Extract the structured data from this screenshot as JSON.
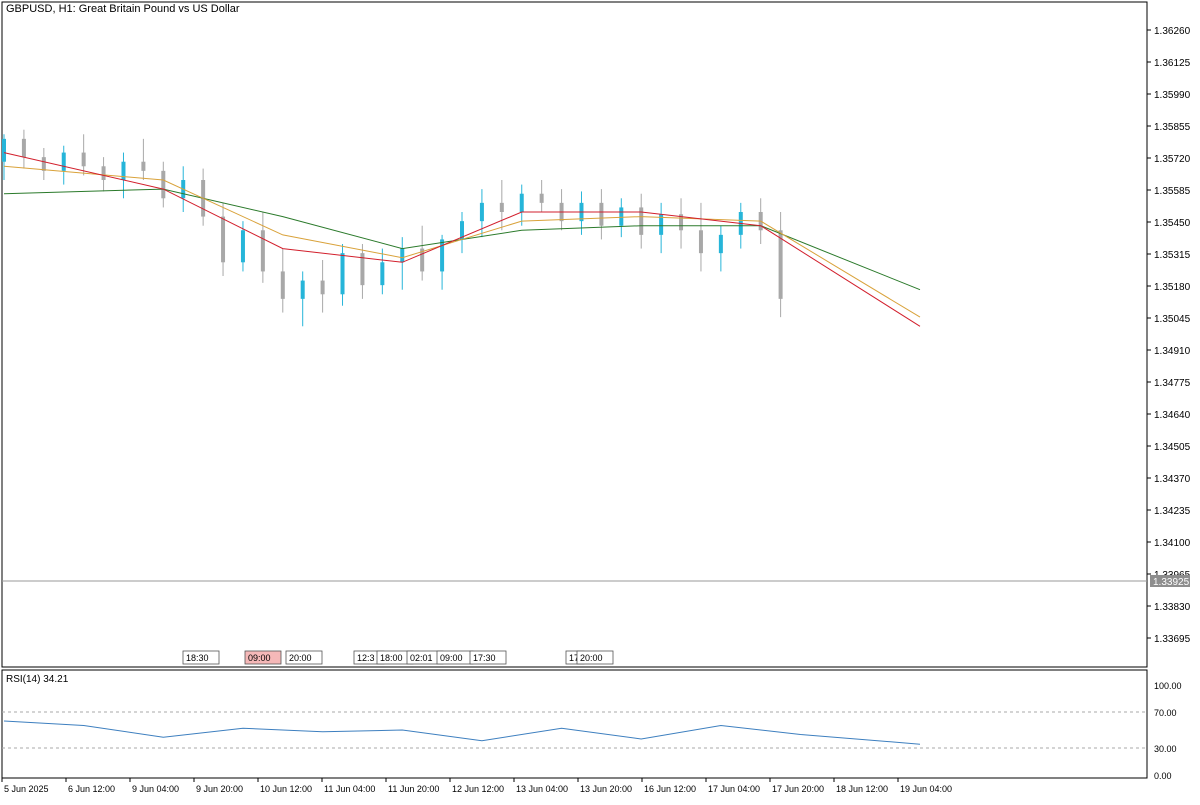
{
  "header": {
    "title": "GBPUSD, H1:  Great Britain Pound vs US Dollar"
  },
  "colors": {
    "bull_candle": "#26b5d9",
    "bear_candle": "#a8a8a8",
    "ma_fast": "#d21f2c",
    "ma_mid": "#d9a23a",
    "ma_slow": "#2b7a2b",
    "rsi_line": "#3d7fbf",
    "grid_frame": "#000000",
    "price_line": "#9a9a9a",
    "event_highlight": "#f5b8b8"
  },
  "price_scale": {
    "labels": [
      "1.36260",
      "1.36125",
      "1.35990",
      "1.35855",
      "1.35720",
      "1.35585",
      "1.35450",
      "1.35315",
      "1.35180",
      "1.35045",
      "1.34910",
      "1.34775",
      "1.34640",
      "1.34505",
      "1.34370",
      "1.34235",
      "1.34100",
      "1.33965",
      "1.33830",
      "1.33695"
    ],
    "current_price": "1.33925"
  },
  "event_markers": [
    {
      "label": "18:30",
      "highlight": false
    },
    {
      "label": "09:00",
      "highlight": true
    },
    {
      "label": "20:00",
      "highlight": false
    },
    {
      "label": "12:3",
      "highlight": false
    },
    {
      "label": "18:00",
      "highlight": false
    },
    {
      "label": "02:01",
      "highlight": false
    },
    {
      "label": "09:00",
      "highlight": false
    },
    {
      "label": "17:30",
      "highlight": false
    },
    {
      "label": "17",
      "highlight": false
    },
    {
      "label": "20:00",
      "highlight": false
    }
  ],
  "rsi_panel": {
    "label": "RSI(14) 34.21",
    "levels": [
      "100.00",
      "70.00",
      "30.00",
      "0.00"
    ]
  },
  "time_axis": {
    "labels": [
      "5 Jun 2025",
      "6 Jun 12:00",
      "9 Jun 04:00",
      "9 Jun 20:00",
      "10 Jun 12:00",
      "11 Jun 04:00",
      "11 Jun 20:00",
      "12 Jun 12:00",
      "13 Jun 04:00",
      "13 Jun 20:00",
      "16 Jun 12:00",
      "17 Jun 04:00",
      "17 Jun 20:00",
      "18 Jun 12:00",
      "19 Jun 04:00"
    ]
  },
  "chart_data": {
    "type": "candlestick",
    "symbol": "GBPUSD",
    "timeframe": "H1",
    "y_range": [
      1.336,
      1.364
    ],
    "grid": false,
    "x_index_range": [
      0,
      230
    ],
    "candles": [
      [
        0,
        1.3578,
        1.359,
        1.357,
        1.3588
      ],
      [
        5,
        1.3588,
        1.3592,
        1.3575,
        1.358
      ],
      [
        10,
        1.358,
        1.3584,
        1.357,
        1.3574
      ],
      [
        15,
        1.3574,
        1.3585,
        1.3568,
        1.3582
      ],
      [
        20,
        1.3582,
        1.359,
        1.3572,
        1.3576
      ],
      [
        25,
        1.3576,
        1.358,
        1.3565,
        1.357
      ],
      [
        30,
        1.357,
        1.3582,
        1.3562,
        1.3578
      ],
      [
        35,
        1.3578,
        1.3588,
        1.357,
        1.3574
      ],
      [
        40,
        1.3574,
        1.3578,
        1.3558,
        1.3562
      ],
      [
        45,
        1.3562,
        1.3576,
        1.3556,
        1.357
      ],
      [
        50,
        1.357,
        1.3575,
        1.355,
        1.3554
      ],
      [
        55,
        1.3554,
        1.356,
        1.3528,
        1.3534
      ],
      [
        60,
        1.3534,
        1.3552,
        1.353,
        1.3548
      ],
      [
        65,
        1.3548,
        1.3556,
        1.3525,
        1.353
      ],
      [
        70,
        1.353,
        1.354,
        1.3512,
        1.3518
      ],
      [
        75,
        1.3518,
        1.353,
        1.3506,
        1.3526
      ],
      [
        80,
        1.3526,
        1.3535,
        1.3512,
        1.352
      ],
      [
        85,
        1.352,
        1.3542,
        1.3515,
        1.3538
      ],
      [
        90,
        1.3538,
        1.3542,
        1.3518,
        1.3524
      ],
      [
        95,
        1.3524,
        1.354,
        1.352,
        1.3534
      ],
      [
        100,
        1.3534,
        1.3545,
        1.3522,
        1.354
      ],
      [
        105,
        1.354,
        1.355,
        1.3526,
        1.353
      ],
      [
        110,
        1.353,
        1.3546,
        1.3522,
        1.3544
      ],
      [
        115,
        1.3544,
        1.3556,
        1.3538,
        1.3552
      ],
      [
        120,
        1.3552,
        1.3566,
        1.3545,
        1.356
      ],
      [
        125,
        1.356,
        1.357,
        1.3548,
        1.3556
      ],
      [
        130,
        1.3556,
        1.3568,
        1.355,
        1.3564
      ],
      [
        135,
        1.3564,
        1.357,
        1.3556,
        1.356
      ],
      [
        140,
        1.356,
        1.3566,
        1.3548,
        1.3552
      ],
      [
        145,
        1.3552,
        1.3565,
        1.3546,
        1.356
      ],
      [
        150,
        1.356,
        1.3566,
        1.3544,
        1.355
      ],
      [
        155,
        1.355,
        1.3562,
        1.3545,
        1.3558
      ],
      [
        160,
        1.3558,
        1.3564,
        1.354,
        1.3546
      ],
      [
        165,
        1.3546,
        1.356,
        1.3538,
        1.3555
      ],
      [
        170,
        1.3555,
        1.3562,
        1.354,
        1.3548
      ],
      [
        175,
        1.3548,
        1.356,
        1.353,
        1.3538
      ],
      [
        180,
        1.3538,
        1.355,
        1.353,
        1.3546
      ],
      [
        185,
        1.3546,
        1.356,
        1.354,
        1.3556
      ],
      [
        190,
        1.3556,
        1.3562,
        1.3542,
        1.3548
      ],
      [
        195,
        1.3548,
        1.3556,
        1.351,
        1.3518
      ]
    ],
    "ma_fast": [
      [
        0,
        1.3582
      ],
      [
        40,
        1.3566
      ],
      [
        70,
        1.354
      ],
      [
        100,
        1.3534
      ],
      [
        130,
        1.3556
      ],
      [
        160,
        1.3556
      ],
      [
        190,
        1.355
      ],
      [
        230,
        1.3506
      ]
    ],
    "ma_mid": [
      [
        0,
        1.3576
      ],
      [
        40,
        1.357
      ],
      [
        70,
        1.3546
      ],
      [
        100,
        1.3536
      ],
      [
        130,
        1.3552
      ],
      [
        160,
        1.3554
      ],
      [
        190,
        1.3552
      ],
      [
        230,
        1.351
      ]
    ],
    "ma_slow": [
      [
        0,
        1.3564
      ],
      [
        40,
        1.3566
      ],
      [
        70,
        1.3554
      ],
      [
        100,
        1.354
      ],
      [
        130,
        1.3548
      ],
      [
        160,
        1.355
      ],
      [
        190,
        1.355
      ],
      [
        230,
        1.3522
      ]
    ],
    "rsi": [
      [
        0,
        60
      ],
      [
        20,
        55
      ],
      [
        40,
        42
      ],
      [
        60,
        52
      ],
      [
        80,
        48
      ],
      [
        100,
        50
      ],
      [
        120,
        38
      ],
      [
        140,
        52
      ],
      [
        160,
        40
      ],
      [
        180,
        55
      ],
      [
        200,
        45
      ],
      [
        230,
        34.21
      ]
    ],
    "rsi_range": [
      0,
      100
    ]
  }
}
